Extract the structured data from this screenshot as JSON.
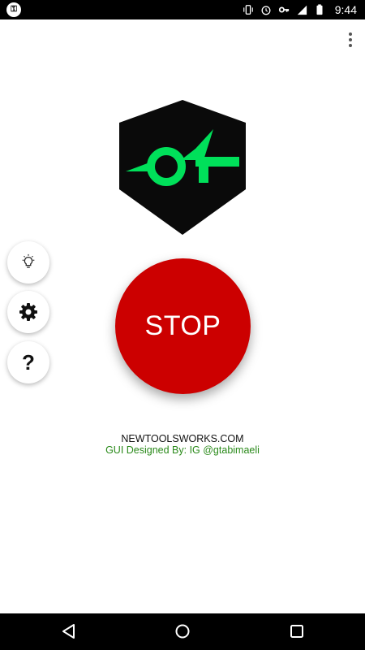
{
  "status_bar": {
    "time": "9:44",
    "icons": [
      "vibrate-icon",
      "alarm-icon",
      "vpn-key-icon",
      "lte-signal-icon",
      "battery-icon"
    ]
  },
  "menu": {
    "icon": "more-vert-icon"
  },
  "logo": {
    "icon": "app-logo",
    "colors": {
      "shield": "#0a0a0a",
      "mark": "#00e05a"
    }
  },
  "side_buttons": [
    {
      "icon": "lightbulb-icon"
    },
    {
      "icon": "gear-icon"
    },
    {
      "icon": "help-icon",
      "glyph": "?"
    }
  ],
  "stop_button": {
    "label": "STOP",
    "color": "#cc0000"
  },
  "credits": {
    "site": "NEWTOOLSWORKS.COM",
    "designer": "GUI  Designed By: IG @gtabimaeli",
    "designer_color": "#2a8a1a"
  },
  "nav_bar": {
    "icons": [
      "back-icon",
      "home-icon",
      "recents-icon"
    ]
  }
}
